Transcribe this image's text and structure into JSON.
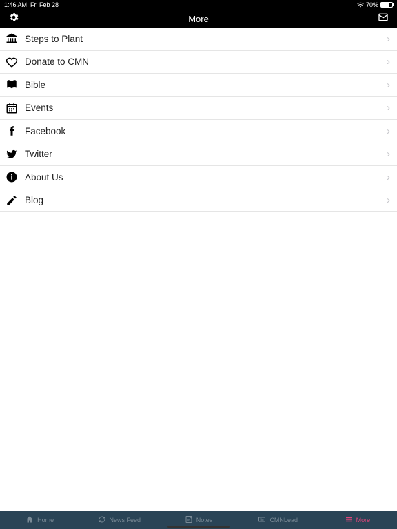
{
  "status": {
    "time": "1:46 AM",
    "date": "Fri Feb 28",
    "battery": "70%"
  },
  "nav": {
    "title": "More"
  },
  "menu": [
    {
      "icon": "bank-icon",
      "label": "Steps to Plant"
    },
    {
      "icon": "heart-icon",
      "label": "Donate to CMN"
    },
    {
      "icon": "book-icon",
      "label": "Bible"
    },
    {
      "icon": "calendar-icon",
      "label": "Events"
    },
    {
      "icon": "facebook-icon",
      "label": "Facebook"
    },
    {
      "icon": "twitter-icon",
      "label": "Twitter"
    },
    {
      "icon": "info-icon",
      "label": "About Us"
    },
    {
      "icon": "pencil-icon",
      "label": "Blog"
    }
  ],
  "tabs": [
    {
      "icon": "home-icon",
      "label": "Home",
      "active": false
    },
    {
      "icon": "refresh-icon",
      "label": "News Feed",
      "active": false
    },
    {
      "icon": "note-icon",
      "label": "Notes",
      "active": false
    },
    {
      "icon": "card-icon",
      "label": "CMNLead",
      "active": false
    },
    {
      "icon": "menu-icon",
      "label": "More",
      "active": true
    }
  ]
}
